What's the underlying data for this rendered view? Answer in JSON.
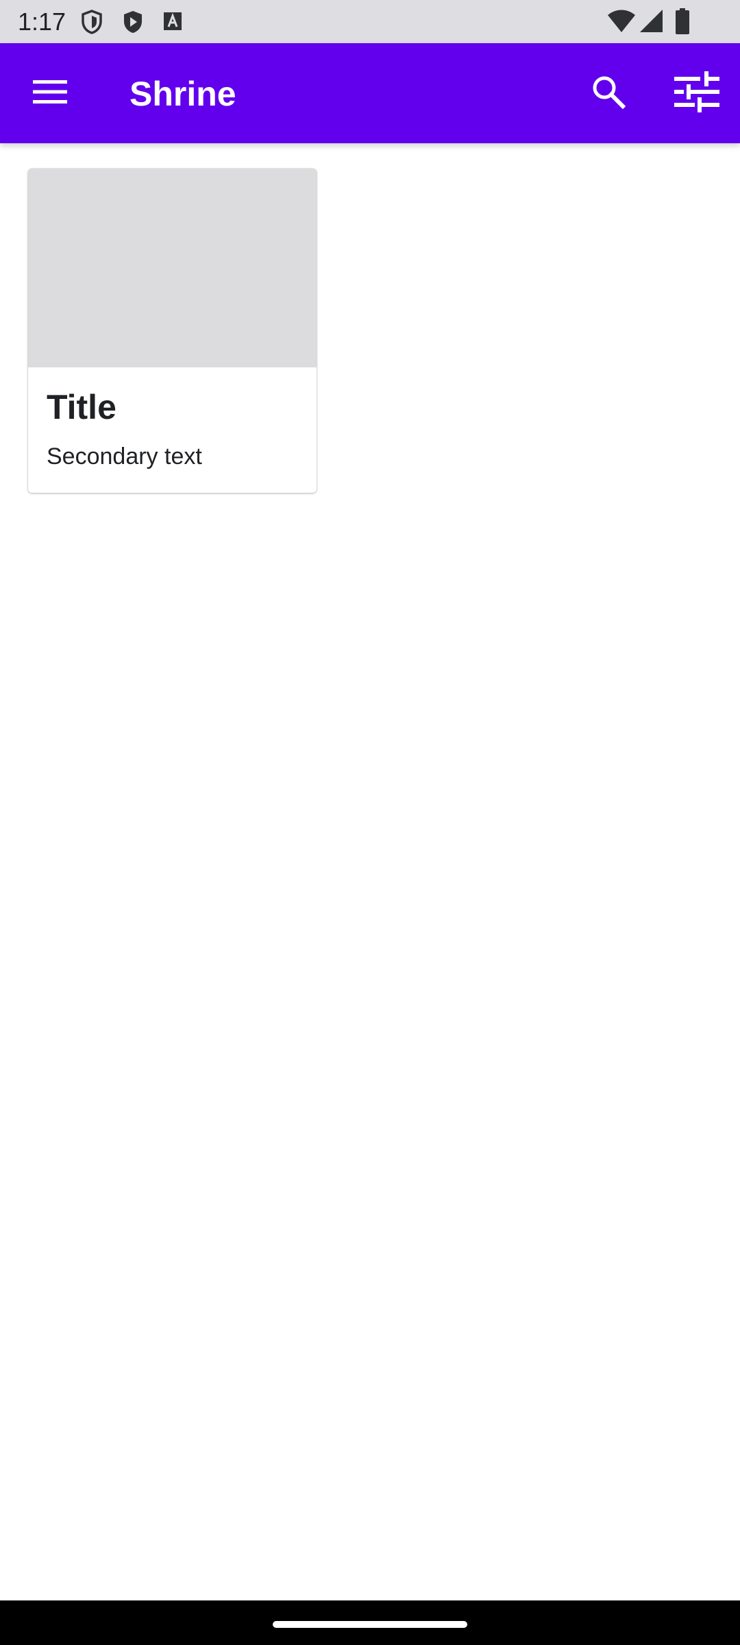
{
  "status_bar": {
    "time": "1:17",
    "left_icons": [
      "shield-outline-icon",
      "shield-play-icon",
      "font-a-icon"
    ],
    "right_icons": [
      "wifi-icon",
      "signal-icon",
      "battery-icon"
    ]
  },
  "app_bar": {
    "title": "Shrine",
    "color": "#6200ee",
    "menu_icon": "menu-icon",
    "search_icon": "search-icon",
    "filter_icon": "tune-icon"
  },
  "cards": [
    {
      "title": "Title",
      "secondary": "Secondary text"
    }
  ]
}
